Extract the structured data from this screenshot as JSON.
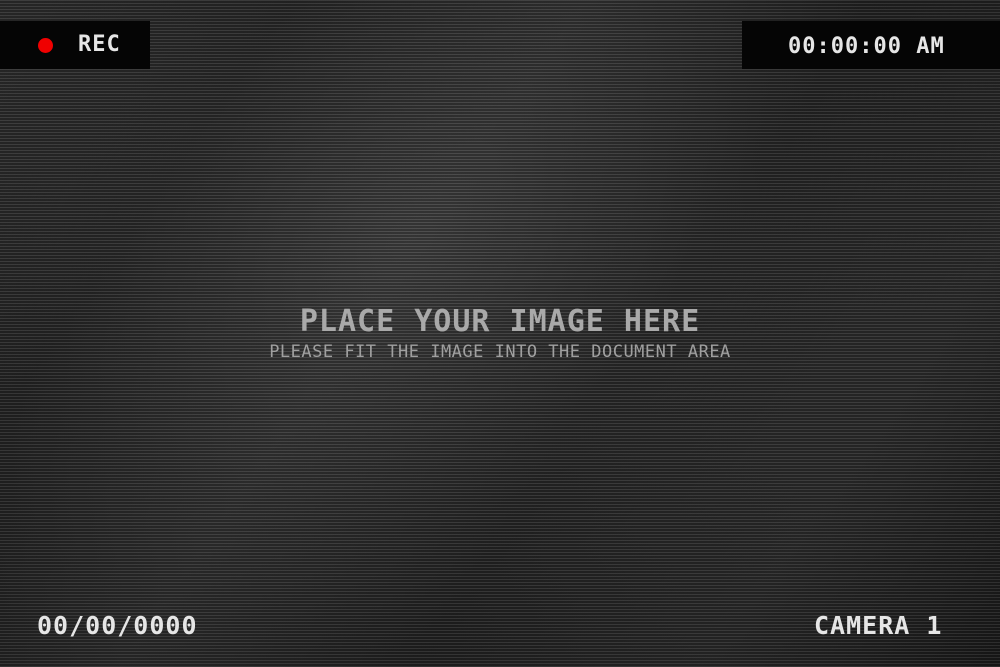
{
  "overlay": {
    "rec_label": "REC",
    "rec_color": "#f00000",
    "time": "00:00:00 AM",
    "date": "00/00/0000",
    "camera": "CAMERA 1"
  },
  "placeholder": {
    "title": "PLACE YOUR IMAGE HERE",
    "subtitle": "PLEASE FIT THE IMAGE INTO THE DOCUMENT AREA"
  }
}
